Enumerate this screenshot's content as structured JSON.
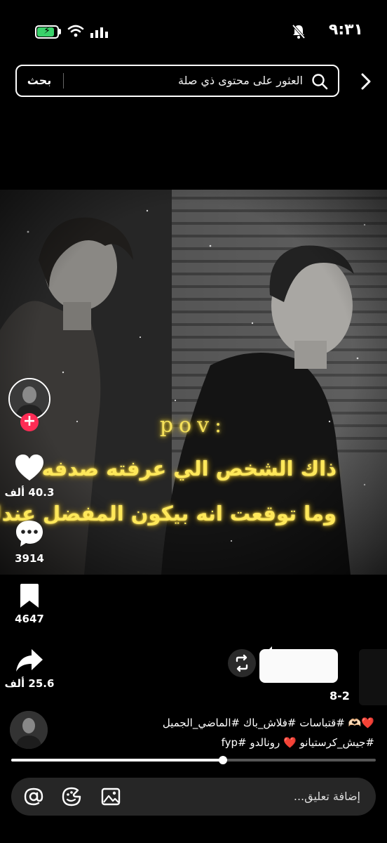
{
  "status_bar": {
    "time": "٩:٣١",
    "icons": [
      "battery-charging-icon",
      "wifi-icon",
      "signal-icon",
      "mute-icon"
    ],
    "battery_level": 0.85
  },
  "search": {
    "placeholder": "العثور على محتوى ذي صلة",
    "button_label": "بحث",
    "icon": "search-icon"
  },
  "video": {
    "overlay_title": "pov:",
    "overlay_line1": "ذاك الشخص الي عرفته صدفه",
    "overlay_line2": "وما توقعت انه بيكون المفضل عندك"
  },
  "actions": {
    "likes": "40.3 ألف",
    "comments": "3914",
    "saves": "4647",
    "shares": "25.6 ألف"
  },
  "caption": {
    "date": "8-2",
    "line1": "❤️🫶🏻 #قتباسات #فلاش_باك #الماضي_الجميل",
    "line2": "#جيش_كرستيانو ❤️ رونالدو #fyp",
    "progress": 0.58
  },
  "comment_bar": {
    "placeholder": "إضافة تعليق...",
    "icons": [
      "image-icon",
      "emoji-icon",
      "mention-icon"
    ]
  },
  "colors": {
    "overlay_text": "#ffe85a",
    "follow": "#fe2c55",
    "battery": "#3ad16a"
  }
}
